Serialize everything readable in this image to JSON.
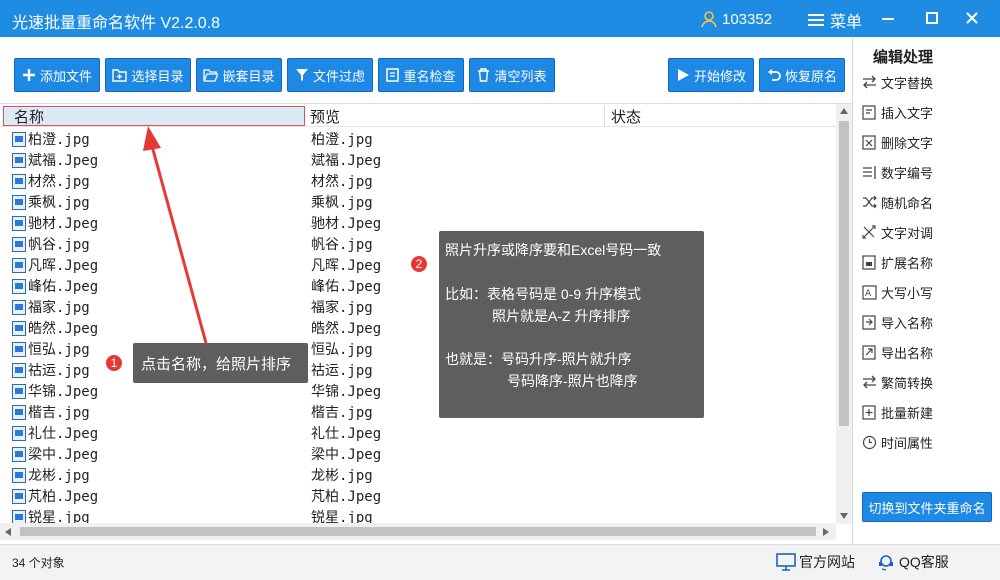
{
  "app": {
    "title": "光速批量重命名软件 V2.2.0.8",
    "user_id": "103352",
    "menu_label": "菜单"
  },
  "toolbar": {
    "add_file": "添加文件",
    "select_dir": "选择目录",
    "nested_dir": "嵌套目录",
    "file_filter": "文件过虑",
    "rename_check": "重名检查",
    "clear_list": "清空列表",
    "start_modify": "开始修改",
    "restore_name": "恢复原名"
  },
  "panel": {
    "title": "编辑处理",
    "items": [
      "文字替换",
      "插入文字",
      "删除文字",
      "数字编号",
      "随机命名",
      "文字对调",
      "扩展名称",
      "大写小写",
      "导入名称",
      "导出名称",
      "繁简转换",
      "批量新建",
      "时间属性"
    ],
    "switch_button": "切换到文件夹重命名"
  },
  "list": {
    "columns": [
      "名称",
      "预览",
      "状态"
    ],
    "rows": [
      {
        "name": "柏澄.jpg",
        "preview": "柏澄.jpg"
      },
      {
        "name": "斌福.Jpeg",
        "preview": "斌福.Jpeg"
      },
      {
        "name": "材然.jpg",
        "preview": "材然.jpg"
      },
      {
        "name": "乘枫.jpg",
        "preview": "乘枫.jpg"
      },
      {
        "name": "驰材.Jpeg",
        "preview": "驰材.Jpeg"
      },
      {
        "name": "帆谷.jpg",
        "preview": "帆谷.jpg"
      },
      {
        "name": "凡晖.Jpeg",
        "preview": "凡晖.Jpeg"
      },
      {
        "name": "峰佑.Jpeg",
        "preview": "峰佑.Jpeg"
      },
      {
        "name": "福家.jpg",
        "preview": "福家.jpg"
      },
      {
        "name": "皓然.Jpeg",
        "preview": "皓然.Jpeg"
      },
      {
        "name": "恒弘.jpg",
        "preview": "恒弘.jpg"
      },
      {
        "name": "祜运.jpg",
        "preview": "祜运.jpg"
      },
      {
        "name": "华锦.Jpeg",
        "preview": "华锦.Jpeg"
      },
      {
        "name": "楷吉.jpg",
        "preview": "楷吉.jpg"
      },
      {
        "name": "礼仕.Jpeg",
        "preview": "礼仕.Jpeg"
      },
      {
        "name": "梁中.Jpeg",
        "preview": "梁中.Jpeg"
      },
      {
        "name": "龙彬.jpg",
        "preview": "龙彬.jpg"
      },
      {
        "name": "芃柏.Jpeg",
        "preview": "芃柏.Jpeg"
      },
      {
        "name": "锐星.jpg",
        "preview": "锐星.jpg"
      }
    ]
  },
  "status": {
    "count": "34 个对象",
    "website": "官方网站",
    "qq_service": "QQ客服"
  },
  "annotations": {
    "badge1": "1",
    "callout1": "点击名称，给照片排序",
    "badge2": "2",
    "callout2_lines": [
      "照片升序或降序要和Excel号码一致",
      "比如：表格号码是 0-9 升序模式",
      "照片就是A-Z 升序排序",
      "也就是：号码升序-照片就升序",
      "号码降序-照片也降序"
    ]
  },
  "colors": {
    "accent": "#1e88e5",
    "titlebar": "#1e8ce3",
    "callout": "#5e5e5e",
    "badge": "#e53935"
  }
}
